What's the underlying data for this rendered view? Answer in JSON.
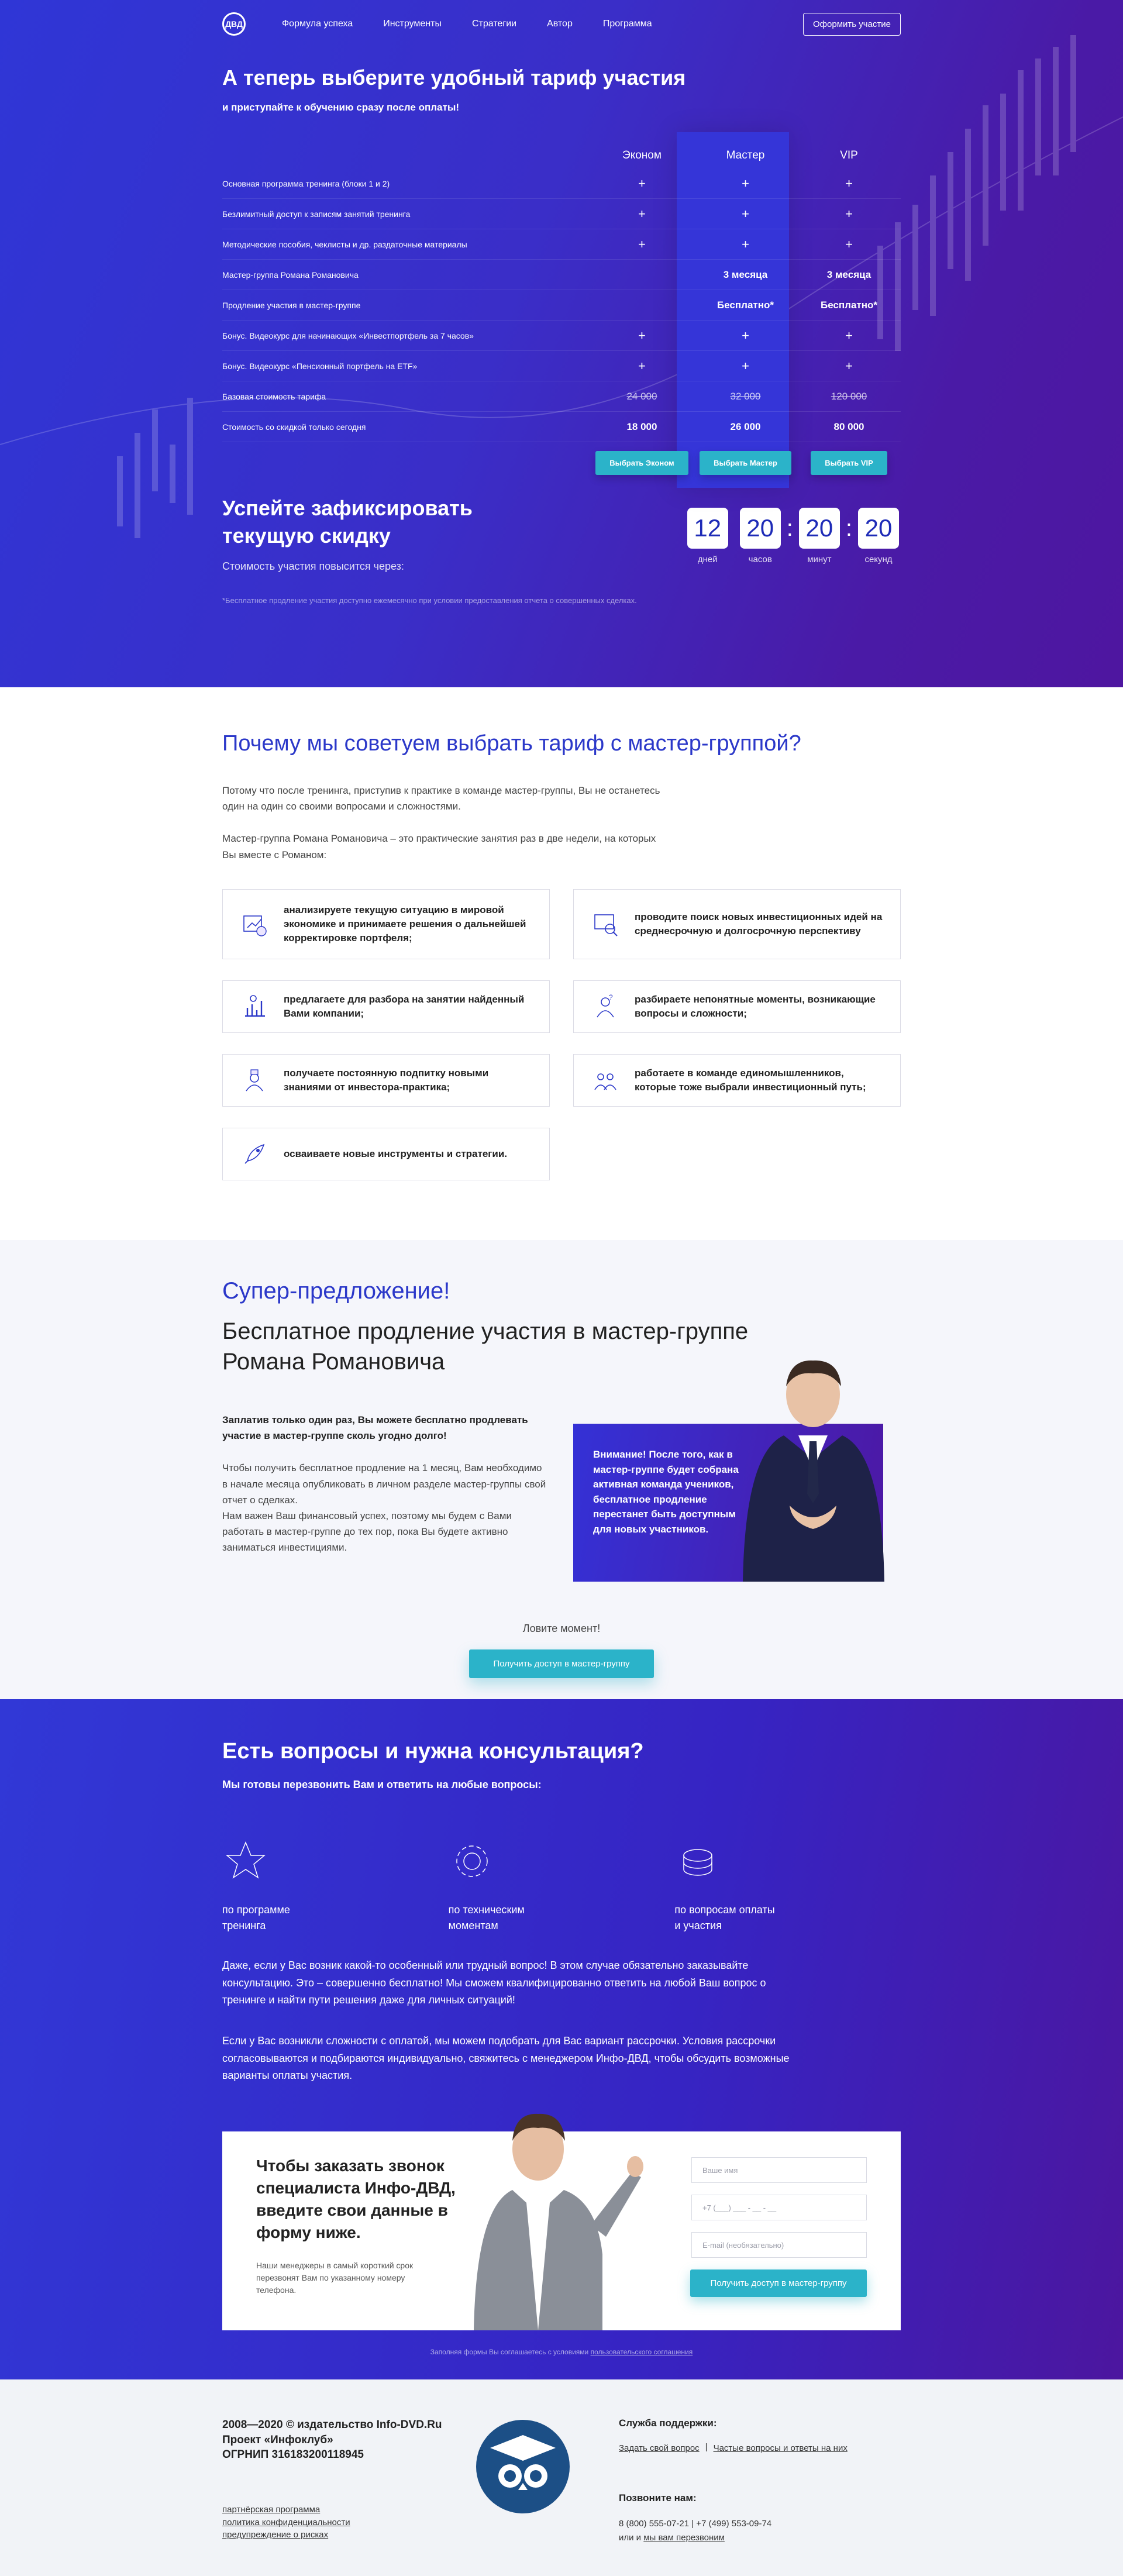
{
  "nav": {
    "logo": "ДВД",
    "links": [
      "Формула успеха",
      "Инструменты",
      "Стратегии",
      "Автор",
      "Программа"
    ],
    "cta": "Оформить участие"
  },
  "pricing": {
    "title": "А теперь выберите удобный тариф участия",
    "subtitle": "и приступайте к обучению сразу после оплаты!",
    "plans": [
      "Эконом",
      "Мастер",
      "VIP"
    ],
    "rows": [
      {
        "feature": "Основная программа тренинга (блоки 1 и 2)",
        "cells": [
          "+",
          "+",
          "+"
        ],
        "kind": "plus"
      },
      {
        "feature": "Безлимитный доступ к записям занятий тренинга",
        "cells": [
          "+",
          "+",
          "+"
        ],
        "kind": "plus"
      },
      {
        "feature": "Методические пособия, чеклисты и др. раздаточные материалы",
        "cells": [
          "+",
          "+",
          "+"
        ],
        "kind": "plus"
      },
      {
        "feature": "Мастер-группа Романа Романовича",
        "cells": [
          "",
          "3 месяца",
          "3 месяца"
        ],
        "kind": "text"
      },
      {
        "feature": "Продление участия в мастер-группе",
        "cells": [
          "",
          "Бесплатно*",
          "Бесплатно*"
        ],
        "kind": "text"
      },
      {
        "feature": "Бонус. Видеокурс для начинающих «Инвестпортфель за 7 часов»",
        "cells": [
          "+",
          "+",
          "+"
        ],
        "kind": "plus"
      },
      {
        "feature": "Бонус. Видеокурс «Пенсионный портфель на ETF»",
        "cells": [
          "+",
          "+",
          "+"
        ],
        "kind": "plus"
      },
      {
        "feature": "Базовая стоимость тарифа",
        "cells": [
          "24 000",
          "32 000",
          "120 000"
        ],
        "kind": "strike"
      },
      {
        "feature": "Стоимость со скидкой только сегодня",
        "cells": [
          "18 000",
          "26 000",
          "80 000"
        ],
        "kind": "text"
      }
    ],
    "buttons": [
      "Выбрать Эконом",
      "Выбрать Мастер",
      "Выбрать VIP"
    ]
  },
  "timer": {
    "title": "Успейте зафиксировать текущую скидку",
    "subtitle": "Стоимость участия повысится через:",
    "values": [
      "12",
      "20",
      "20",
      "20"
    ],
    "labels": [
      "дней",
      "часов",
      "минут",
      "секунд"
    ],
    "note": "*Бесплатное продление участия доступно ежемесячно при условии предоставления отчета о совершенных сделках."
  },
  "why": {
    "title": "Почему мы советуем выбрать тариф с мастер-группой?",
    "p1": "Потому что после тренинга, приступив к практике в команде мастер-группы, Вы не останетесь один на один со своими вопросами и сложностями.",
    "p2": "Мастер-группа Романа Романовича – это практические занятия раз в две недели, на которых Вы вместе с Романом:",
    "items": [
      {
        "icon": "chart-analysis-icon",
        "text": "анализируете текущую ситуацию в мировой экономике и принимаете решения о дальнейшей корректировке портфеля;"
      },
      {
        "icon": "search-ideas-icon",
        "text": "проводите поиск новых инвестиционных идей на среднесрочную и долгосрочную перспективу"
      },
      {
        "icon": "company-chart-icon",
        "text": "предлагаете для разбора на занятии найденный Вами компании;"
      },
      {
        "icon": "question-person-icon",
        "text": "разбираете непонятные моменты, возникающие вопросы и сложности;"
      },
      {
        "icon": "knowledge-person-icon",
        "text": "получаете постоянную подпитку новыми знаниями от инвестора-практика;"
      },
      {
        "icon": "team-icon",
        "text": "работаете в команде единомышленников, которые тоже выбрали инвестиционный путь;"
      },
      {
        "icon": "rocket-icon",
        "text": "осваиваете новые инструменты и стратегии."
      }
    ]
  },
  "offer": {
    "tag": "Супер-предложение!",
    "title": "Бесплатное продление участия в мастер-группе Романа Романовича",
    "bold": "Заплатив только один раз, Вы можете бесплатно продлевать участие в мастер-группе сколь угодно долго!",
    "p1": "Чтобы получить бесплатное продление на 1 месяц, Вам необходимо в начале месяца опубликовать в личном разделе мастер-группы свой отчет о сделках.",
    "p2": "Нам важен Ваш финансовый успех, поэтому мы будем с Вами работать в мастер-группе до тех пор, пока Вы будете активно заниматься инвестициями.",
    "attention": "Внимание! После того, как в мастер-группе будет собрана активная команда учеников, бесплатное продление перестанет быть доступным для новых участников.",
    "catch": "Ловите момент!",
    "cta": "Получить доступ в мастер-группу"
  },
  "questions": {
    "title": "Есть вопросы и нужна консультация?",
    "subtitle": "Мы готовы перезвонить Вам и ответить на любые вопросы:",
    "topics": [
      {
        "icon": "star-icon",
        "l1": "по программе",
        "l2": "тренинга"
      },
      {
        "icon": "gear-icon",
        "l1": "по техническим",
        "l2": "моментам"
      },
      {
        "icon": "coins-icon",
        "l1": "по вопросам оплаты",
        "l2": "и участия"
      }
    ],
    "p1": "Даже, если у Вас возник какой-то особенный или трудный вопрос! В этом случае обязательно заказывайте консультацию. Это – совершенно бесплатно! Мы сможем квалифицированно ответить на любой Ваш вопрос о тренинге и найти пути решения даже для личных ситуаций!",
    "p2": "Если у Вас возникли сложности с оплатой, мы можем подобрать для Вас вариант рассрочки. Условия рассрочки согласовываются и подбираются индивидуально, свяжитесь с менеджером Инфо-ДВД, чтобы обсудить возможные варианты оплаты участия.",
    "form": {
      "title": "Чтобы заказать звонок специалиста Инфо-ДВД, введите свои данные в форму ниже.",
      "note": "Наши менеджеры в самый короткий срок перезвонят Вам по указанному номеру телефона.",
      "name_placeholder": "Ваше имя",
      "phone_placeholder": "+7 (___) ___ - __ - __",
      "email_placeholder": "E-mail (необязательно)",
      "submit": "Получить доступ в мастер-группу"
    },
    "consent_prefix": "Заполняя формы Вы соглашаетесь с условиями",
    "consent_link": "пользовательского соглашения"
  },
  "footer": {
    "line1": "2008—2020 © издательство Info-DVD.Ru",
    "line2": "Проект «Инфоклуб»",
    "line3": "ОГРНИП 316183200118945",
    "links": [
      "партнёрская программа",
      "политика конфиденциальности",
      "предупреждение о рисках"
    ],
    "support_title": "Служба поддержки:",
    "support_link1": "Задать свой вопрос",
    "support_link2": "Частые вопросы и ответы на них",
    "call_title": "Позвоните нам:",
    "phones": "8 (800) 555-07-21 | +7 (499) 553-09-74",
    "or": "или и",
    "callback_link": "мы вам перезвоним"
  },
  "colors": {
    "brand_blue": "#2f36d6",
    "brand_purple": "#4e16a0",
    "accent": "#2bb3c9",
    "heading_blue": "#2b38c9"
  }
}
